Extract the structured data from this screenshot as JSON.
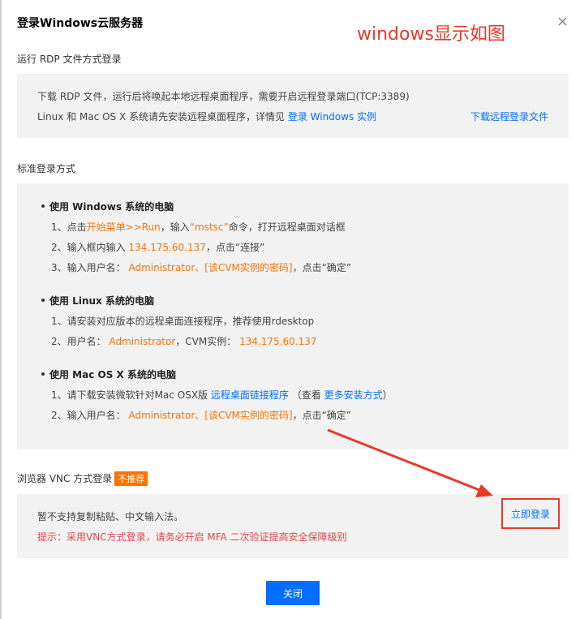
{
  "dialog": {
    "title": "登录Windows云服务器",
    "annotation": "windows显示如图",
    "close_icon": "×"
  },
  "rdp": {
    "section_label": "运行 RDP 文件方式登录",
    "line1": "下载 RDP 文件，运行后将唤起本地远程桌面程序，需要开启远程登录端口(TCP:3389)",
    "line2_prefix": "Linux 和 Mac OS X 系统请先安装远程桌面程序，详情见",
    "line2_link": "登录 Windows 实例",
    "download_link": "下载远程登录文件"
  },
  "standard": {
    "section_label": "标准登录方式",
    "windows": {
      "title": "使用 Windows 系统的电脑",
      "s1_prefix": "1、点击",
      "s1_orange1": "开始菜单>>Run",
      "s1_mid": "，输入",
      "s1_orange2": "“mstsc”",
      "s1_suffix": "命令，打开远程桌面对话框",
      "s2_prefix": "2、输入框内输入",
      "s2_ip": "134.175.60.137",
      "s2_suffix": "，点击“连接”",
      "s3_prefix": "3、输入用户名：",
      "s3_orange": "Administrator、[该CVM实例的密码]",
      "s3_suffix": "，点击“确定”"
    },
    "linux": {
      "title": "使用 Linux 系统的电脑",
      "s1": "1、请安装对应版本的远程桌面连接程序，推荐使用rdesktop",
      "s2_prefix": "2、用户名：",
      "s2_user": "Administrator",
      "s2_mid": "，CVM实例：",
      "s2_ip": "134.175.60.137"
    },
    "mac": {
      "title": "使用 Mac OS X 系统的电脑",
      "s1_prefix": "1、请下载安装微软针对Mac OSX版",
      "s1_link": "远程桌面链接程序",
      "s1_mid": "（查看",
      "s1_link2": "更多安装方式",
      "s1_suffix": "）",
      "s2_prefix": "2、输入用户名：",
      "s2_orange": "Administrator、[该CVM实例的密码]",
      "s2_suffix": "，点击“确定”"
    }
  },
  "vnc": {
    "section_label": "浏览器 VNC 方式登录",
    "badge": "不推荐",
    "line1": "暂不支持复制粘贴、中文输入法。",
    "line2": "提示：采用VNC方式登录，请务必开启 MFA 二次验证提高安全保障级别",
    "login_button": "立即登录"
  },
  "footer": {
    "close_button": "关闭"
  },
  "colors": {
    "link": "#006eff",
    "orange": "#ff7200",
    "annotation_red": "#e8382a",
    "panel_bg": "#f2f2f2",
    "primary_button": "#006eff"
  }
}
